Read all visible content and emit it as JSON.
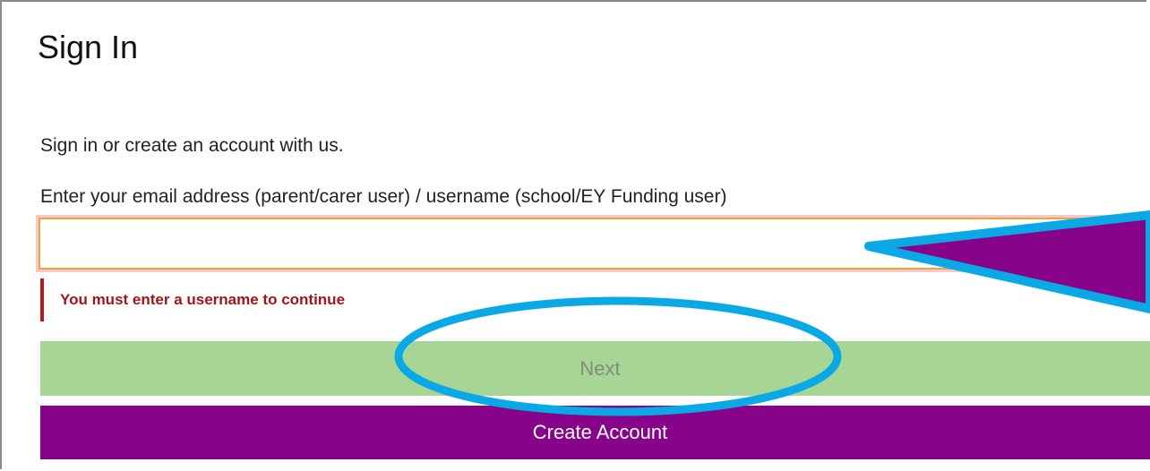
{
  "page": {
    "title": "Sign In",
    "intro": "Sign in or create an account with us.",
    "field_label": "Enter your email address (parent/carer user) / username (school/EY Funding user)"
  },
  "username_input": {
    "value": "",
    "placeholder": ""
  },
  "error": {
    "message": "You must enter a username to continue"
  },
  "buttons": {
    "next_label": "Next",
    "create_account_label": "Create Account"
  },
  "colors": {
    "next_bg": "#a7d595",
    "create_bg": "#87038a",
    "error_text": "#a1151b",
    "annotation_stroke": "#0aa9e6",
    "annotation_fill": "#87038a"
  }
}
